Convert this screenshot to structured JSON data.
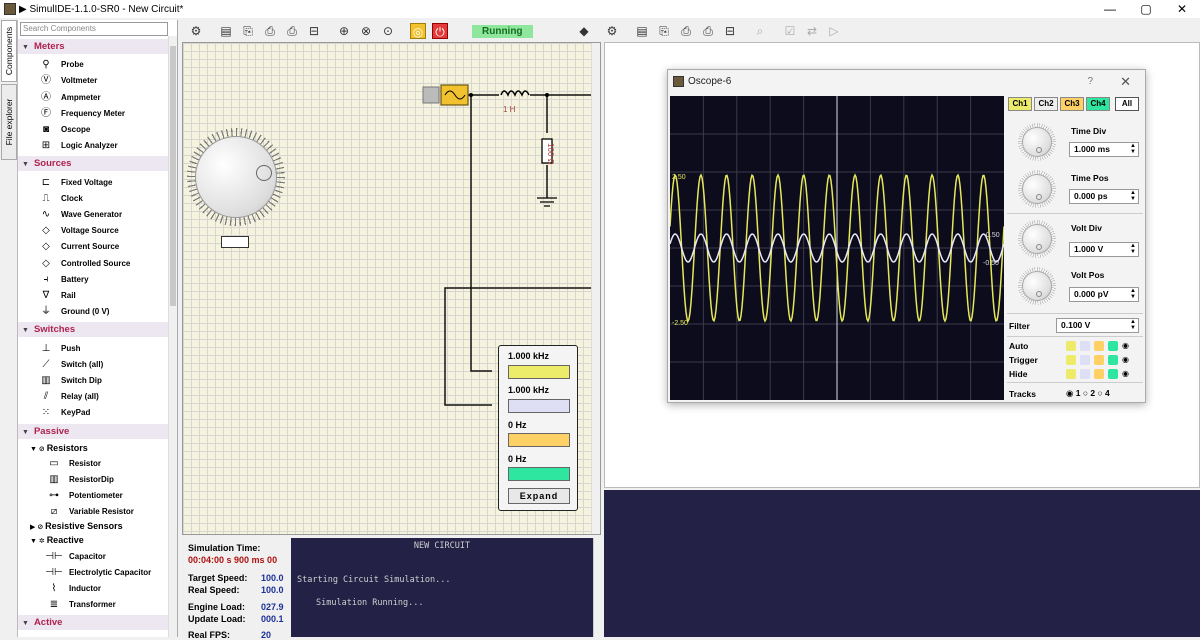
{
  "window": {
    "title": "▶ SimulIDE-1.1.0-SR0 - New Circuit*",
    "minimize": "—",
    "maximize": "▢",
    "close": "✕"
  },
  "vtabs": {
    "components": "Components",
    "file_explorer": "File explorer"
  },
  "search": {
    "placeholder": "Search Components"
  },
  "categories": {
    "meters": {
      "label": "Meters",
      "items": [
        {
          "label": "Probe",
          "icon": "probe-icon"
        },
        {
          "label": "Voltmeter",
          "icon": "voltmeter-icon"
        },
        {
          "label": "Ampmeter",
          "icon": "ampmeter-icon"
        },
        {
          "label": "Frequency Meter",
          "icon": "frequency-meter-icon"
        },
        {
          "label": "Oscope",
          "icon": "oscope-icon"
        },
        {
          "label": "Logic Analyzer",
          "icon": "logic-analyzer-icon"
        }
      ]
    },
    "sources": {
      "label": "Sources",
      "items": [
        {
          "label": "Fixed Voltage"
        },
        {
          "label": "Clock"
        },
        {
          "label": "Wave Generator"
        },
        {
          "label": "Voltage Source"
        },
        {
          "label": "Current Source"
        },
        {
          "label": "Controlled Source"
        },
        {
          "label": "Battery"
        },
        {
          "label": "Rail"
        },
        {
          "label": "Ground (0 V)"
        }
      ]
    },
    "switches": {
      "label": "Switches",
      "items": [
        {
          "label": "Push"
        },
        {
          "label": "Switch (all)"
        },
        {
          "label": "Switch Dip"
        },
        {
          "label": "Relay (all)"
        },
        {
          "label": "KeyPad"
        }
      ]
    },
    "passive": {
      "label": "Passive",
      "resistors": "Resistors",
      "resistor_items": [
        {
          "label": "Resistor"
        },
        {
          "label": "ResistorDip"
        },
        {
          "label": "Potentiometer"
        },
        {
          "label": "Variable Resistor"
        }
      ],
      "resistive_sensors": "Resistive Sensors",
      "reactive": "Reactive",
      "reactive_items": [
        {
          "label": "Capacitor"
        },
        {
          "label": "Electrolytic Capacitor"
        },
        {
          "label": "Inductor"
        },
        {
          "label": "Transformer"
        }
      ]
    },
    "active": {
      "label": "Active"
    }
  },
  "toolbar": {
    "status": "Running"
  },
  "circuit": {
    "inductor_label": "1 H",
    "resistor_label": "100 Ω"
  },
  "freqmeter": {
    "ch1": "1.000 kHz",
    "ch2": "1.000 kHz",
    "ch3": "0 Hz",
    "ch4": "0 Hz",
    "expand": "Expand"
  },
  "status": {
    "sim_time_label": "Simulation Time:",
    "sim_time": "00:04:00 s  900 ms  00",
    "target_speed_label": "Target Speed:",
    "target_speed": "100.0",
    "real_speed_label": "Real Speed:",
    "real_speed": "100.0",
    "engine_load_label": "Engine Load:",
    "engine_load": "027.9",
    "update_load_label": "Update Load:",
    "update_load": "000.1",
    "fps_label": "Real FPS:",
    "fps": "20"
  },
  "console": {
    "header": "NEW CIRCUIT",
    "line1": "Starting Circuit Simulation...",
    "line2": "Simulation Running..."
  },
  "oscope": {
    "title": "Oscope-6",
    "help": "?",
    "close": "✕",
    "channels": [
      "Ch1",
      "Ch2",
      "Ch3",
      "Ch4",
      "All"
    ],
    "time_div_label": "Time Div",
    "time_div": "1.000 ms",
    "time_pos_label": "Time Pos",
    "time_pos": "0.000 ps",
    "volt_div_label": "Volt Div",
    "volt_div": "1.000 V",
    "volt_pos_label": "Volt Pos",
    "volt_pos": "0.000 pV",
    "filter_label": "Filter",
    "filter": "0.100 V",
    "auto_label": "Auto",
    "trigger_label": "Trigger",
    "hide_label": "Hide",
    "tracks_label": "Tracks",
    "tracks": [
      "1",
      "2",
      "4"
    ],
    "y_labels": {
      "top": "2.50",
      "bottom": "-2.50",
      "right_top": "0.50",
      "right_bottom": "-0.50"
    }
  },
  "colors": {
    "ch1": "#e6e65a",
    "ch2": "#d7d7f5",
    "ch3": "#ffd066",
    "ch4": "#2ee6a0",
    "accent": "#b0224e"
  }
}
